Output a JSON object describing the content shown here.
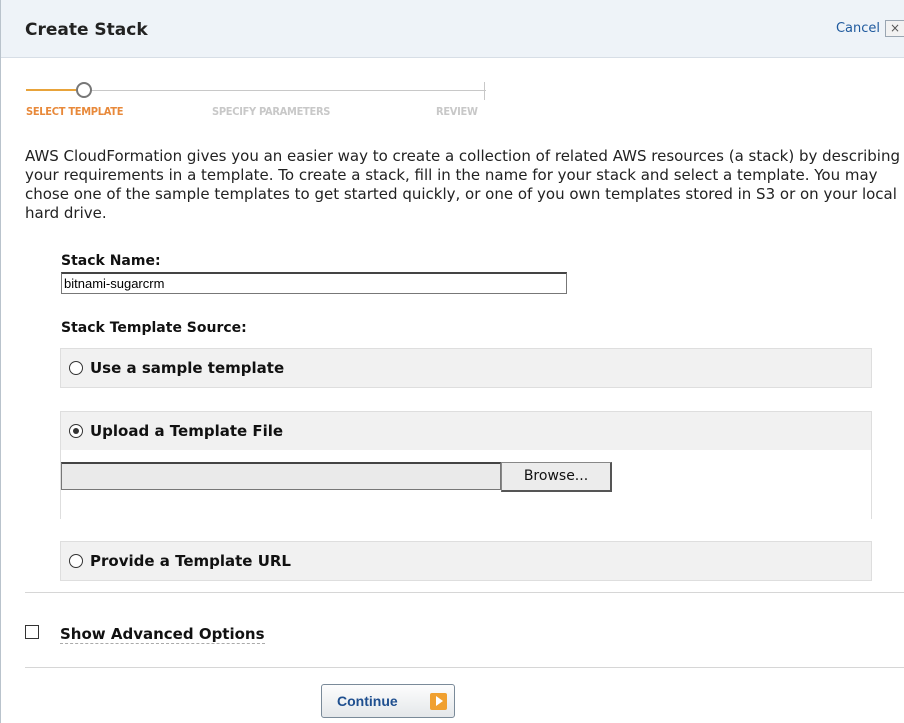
{
  "dialog": {
    "title": "Create Stack",
    "cancel_label": "Cancel",
    "close_glyph": "×"
  },
  "wizard": {
    "steps": [
      {
        "label": "SELECT TEMPLATE",
        "state": "active"
      },
      {
        "label": "SPECIFY PARAMETERS",
        "state": "todo"
      },
      {
        "label": "REVIEW",
        "state": "todo"
      }
    ]
  },
  "intro_text": "AWS CloudFormation gives you an easier way to create a collection of related AWS resources (a stack) by describing your requirements in a template. To create a stack, fill in the name for your stack and select a template. You may chose one of the sample templates to get started quickly, or one of you own templates stored in S3 or on your local hard drive.",
  "stack_name": {
    "label": "Stack Name:",
    "value": "bitnami-sugarcrm"
  },
  "template_source": {
    "label": "Stack Template Source:",
    "options": [
      {
        "label": "Use a sample template",
        "selected": false
      },
      {
        "label": "Upload a Template File",
        "selected": true
      },
      {
        "label": "Provide a Template URL",
        "selected": false
      }
    ],
    "upload": {
      "file_value": "",
      "browse_label": "Browse..."
    }
  },
  "advanced": {
    "label": "Show Advanced Options",
    "checked": false
  },
  "continue_label": "Continue",
  "colors": {
    "active_step": "#e8893a",
    "link": "#1f5a9e",
    "button_text": "#1f4f8f",
    "arrow": "#f0a030"
  }
}
